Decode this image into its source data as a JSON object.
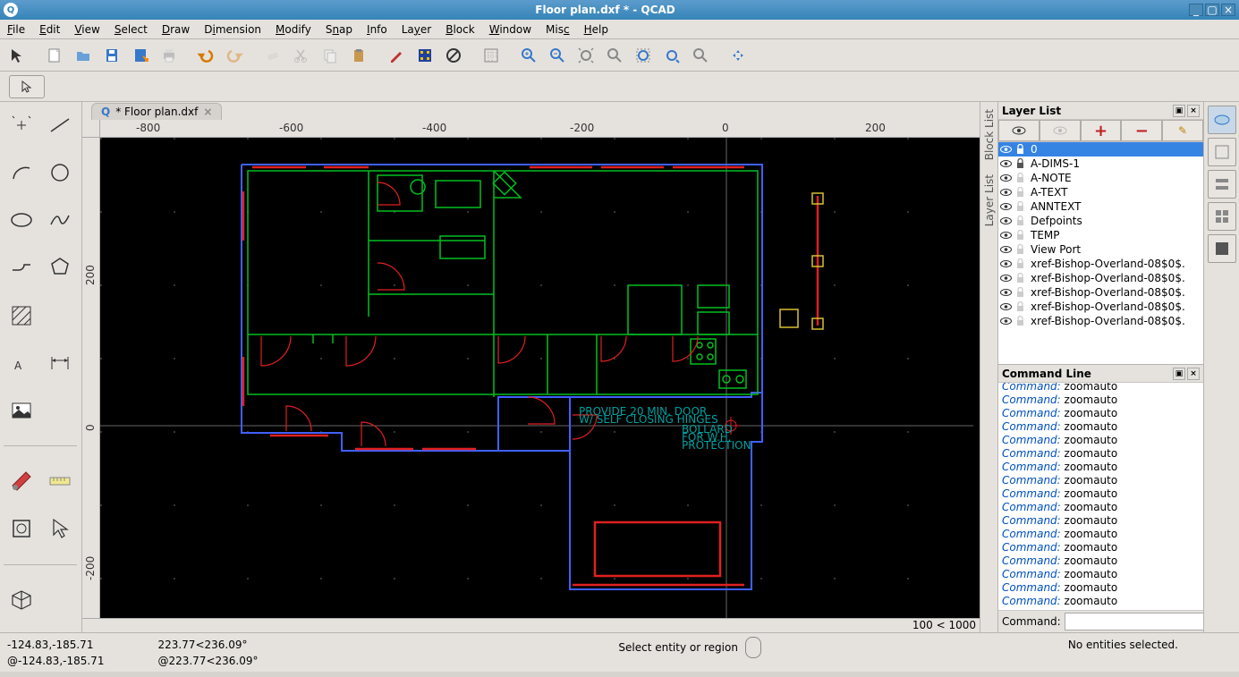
{
  "window": {
    "title": "Floor plan.dxf * - QCAD",
    "min": "_",
    "max": "▢",
    "close": "×"
  },
  "menu": [
    "File",
    "Edit",
    "View",
    "Select",
    "Draw",
    "Dimension",
    "Modify",
    "Snap",
    "Info",
    "Layer",
    "Block",
    "Window",
    "Misc",
    "Help"
  ],
  "tab": {
    "label": "* Floor plan.dxf",
    "close": "×"
  },
  "ruler_h": [
    "-800",
    "-600",
    "-400",
    "-200",
    "0",
    "200"
  ],
  "ruler_v": [
    "200",
    "0",
    "-200"
  ],
  "footer_right": "100 < 1000",
  "annotations": {
    "a1": "PROVIDE 20 MIN. DOOR",
    "a2": "W/ SELF CLOSING HINGES",
    "a3": "BOLLARD",
    "a4": "FOR W.H.",
    "a5": "PROTECTION"
  },
  "vtabs": [
    "Block List",
    "Layer List"
  ],
  "layer_panel": {
    "title": "Layer List",
    "btn_add": "+",
    "btn_remove": "−",
    "btn_edit": "✎"
  },
  "layers": [
    {
      "name": "0",
      "sel": true,
      "vis": true,
      "lock": true
    },
    {
      "name": "A-DIMS-1",
      "sel": false,
      "vis": true,
      "lock": true
    },
    {
      "name": "A-NOTE",
      "sel": false,
      "vis": true,
      "lock": false
    },
    {
      "name": "A-TEXT",
      "sel": false,
      "vis": true,
      "lock": false
    },
    {
      "name": "ANNTEXT",
      "sel": false,
      "vis": true,
      "lock": false
    },
    {
      "name": "Defpoints",
      "sel": false,
      "vis": true,
      "lock": false
    },
    {
      "name": "TEMP",
      "sel": false,
      "vis": true,
      "lock": false
    },
    {
      "name": "View Port",
      "sel": false,
      "vis": true,
      "lock": false
    },
    {
      "name": "xref-Bishop-Overland-08$0$.",
      "sel": false,
      "vis": true,
      "lock": false
    },
    {
      "name": "xref-Bishop-Overland-08$0$.",
      "sel": false,
      "vis": true,
      "lock": false
    },
    {
      "name": "xref-Bishop-Overland-08$0$.",
      "sel": false,
      "vis": true,
      "lock": false
    },
    {
      "name": "xref-Bishop-Overland-08$0$.",
      "sel": false,
      "vis": true,
      "lock": false
    },
    {
      "name": "xref-Bishop-Overland-08$0$.",
      "sel": false,
      "vis": true,
      "lock": false
    }
  ],
  "cmd_panel": {
    "title": "Command Line",
    "prompt": "Command:"
  },
  "cmd_log": [
    {
      "c": "Command:",
      "t": " zoomauto"
    },
    {
      "c": "Command:",
      "t": " zoomauto"
    },
    {
      "c": "Command:",
      "t": " zoomauto"
    },
    {
      "c": "Command:",
      "t": " zoomauto"
    },
    {
      "c": "Command:",
      "t": " zoomauto"
    },
    {
      "c": "Command:",
      "t": " zoomauto"
    },
    {
      "c": "Command:",
      "t": " zoomauto"
    },
    {
      "c": "Command:",
      "t": " zoomauto"
    },
    {
      "c": "Command:",
      "t": " zoomauto"
    },
    {
      "c": "Command:",
      "t": " zoomauto"
    },
    {
      "c": "Command:",
      "t": " zoomauto"
    },
    {
      "c": "Command:",
      "t": " zoomauto"
    },
    {
      "c": "Command:",
      "t": " zoomauto"
    },
    {
      "c": "Command:",
      "t": " zoomauto"
    },
    {
      "c": "Command:",
      "t": " zoomauto"
    },
    {
      "c": "Command:",
      "t": " zoomauto"
    },
    {
      "c": "Command:",
      "t": " zoomauto"
    }
  ],
  "status": {
    "coord1": "-124.83,-185.71",
    "coord2": "@-124.83,-185.71",
    "angle1": "223.77<236.09°",
    "angle2": "@223.77<236.09°",
    "prompt": "Select entity or region",
    "sel": "No entities selected."
  }
}
